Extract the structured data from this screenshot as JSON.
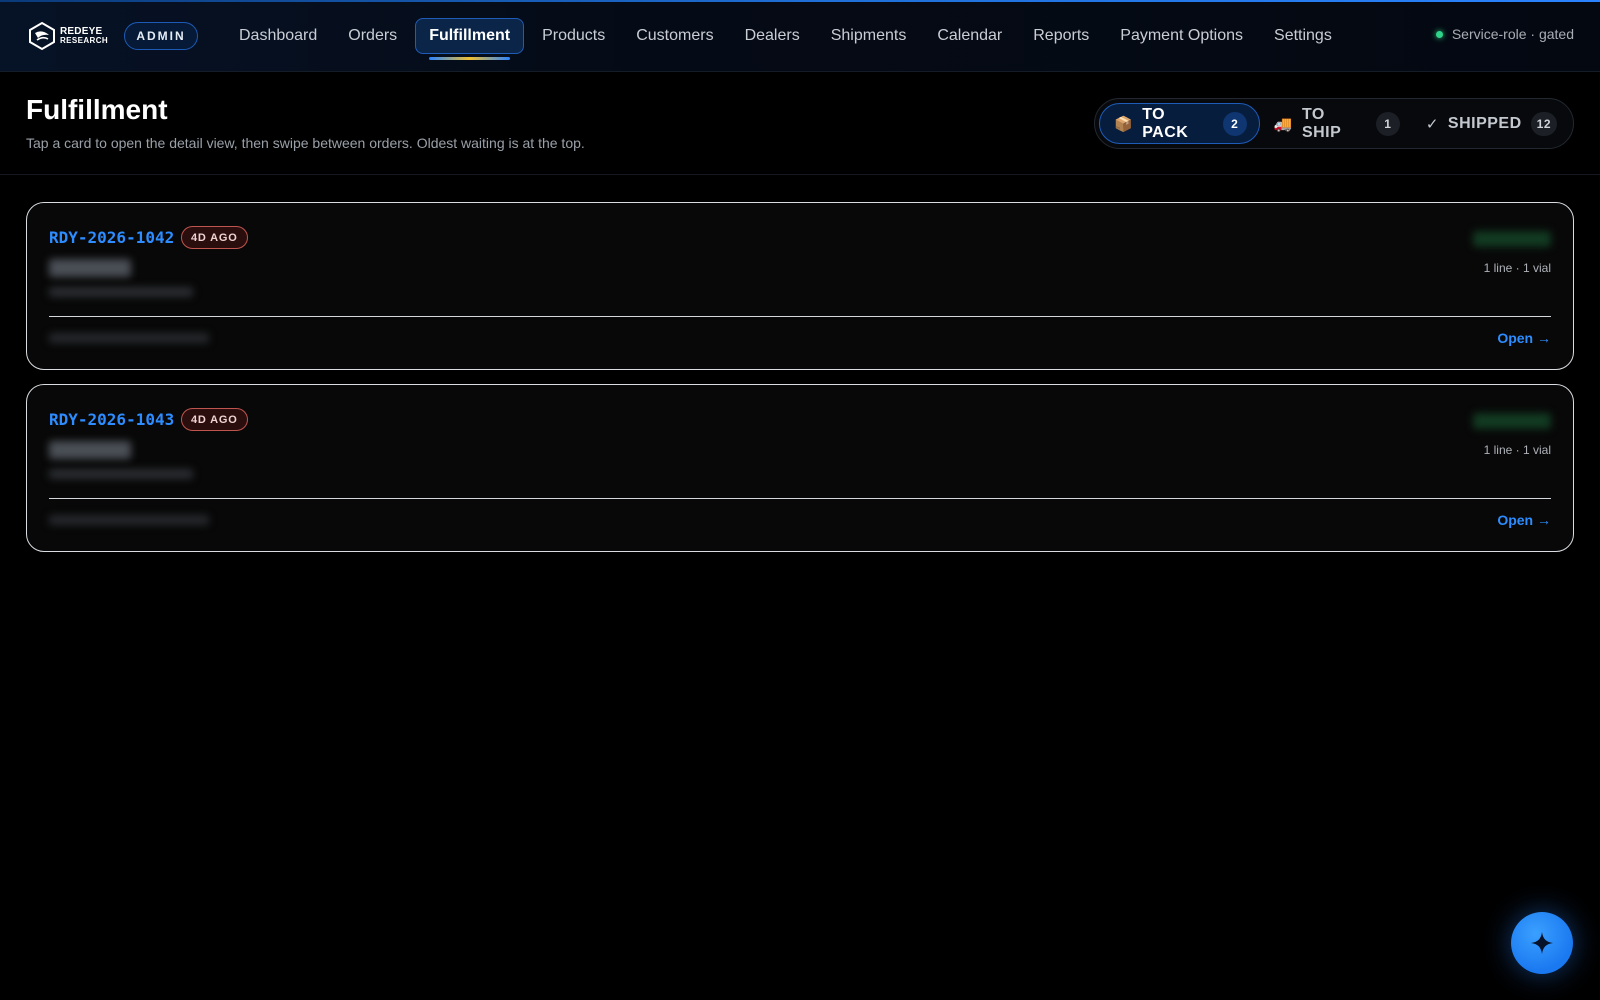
{
  "brand": {
    "line1": "REDEYE",
    "line2": "RESEARCH",
    "role_badge": "ADMIN"
  },
  "nav": {
    "items": [
      {
        "label": "Dashboard",
        "active": false
      },
      {
        "label": "Orders",
        "active": false
      },
      {
        "label": "Fulfillment",
        "active": true
      },
      {
        "label": "Products",
        "active": false
      },
      {
        "label": "Customers",
        "active": false
      },
      {
        "label": "Dealers",
        "active": false
      },
      {
        "label": "Shipments",
        "active": false
      },
      {
        "label": "Calendar",
        "active": false
      },
      {
        "label": "Reports",
        "active": false
      },
      {
        "label": "Payment Options",
        "active": false
      },
      {
        "label": "Settings",
        "active": false
      }
    ]
  },
  "status": {
    "label": "Service-role · gated",
    "color": "#2fd48a"
  },
  "header": {
    "title": "Fulfillment",
    "subtitle": "Tap a card to open the detail view, then swipe between orders. Oldest waiting is at the top."
  },
  "segments": [
    {
      "icon": "package-icon",
      "label": "TO PACK",
      "count": "2",
      "active": true
    },
    {
      "icon": "truck-icon",
      "label": "TO SHIP",
      "count": "1",
      "active": false
    },
    {
      "icon": "check-icon",
      "label": "SHIPPED",
      "count": "12",
      "active": false
    }
  ],
  "orders": [
    {
      "id": "RDY-2026-1042",
      "age": "4D AGO",
      "summary": "1 line · 1 vial",
      "action": "Open →"
    },
    {
      "id": "RDY-2026-1043",
      "age": "4D AGO",
      "summary": "1 line · 1 vial",
      "action": "Open →"
    }
  ],
  "colors": {
    "accent": "#2d8cff",
    "age_badge": "#c0554f",
    "brand_bar": "#1f6fd6"
  },
  "fab": {
    "icon": "sparkle-icon"
  }
}
